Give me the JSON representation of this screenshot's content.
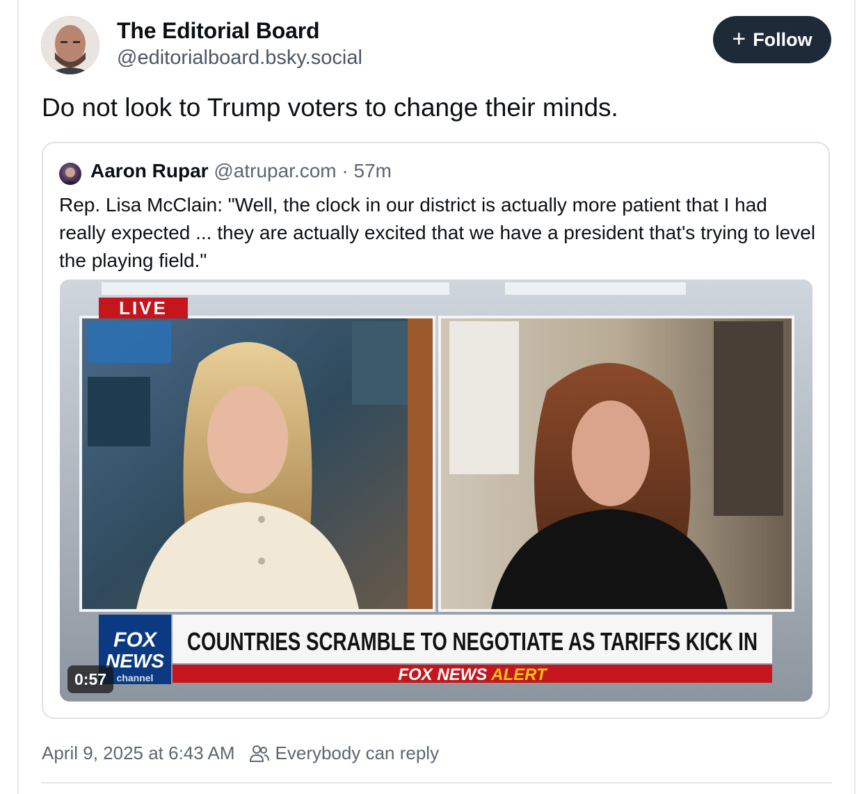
{
  "post": {
    "author": {
      "display_name": "The Editorial Board",
      "handle": "@editorialboard.bsky.social"
    },
    "follow_label": "Follow",
    "text": "Do not look to Trump voters to change their minds.",
    "timestamp": "April 9, 2025 at 6:43 AM",
    "reply_setting": "Everybody can reply"
  },
  "quote": {
    "author_name": "Aaron Rupar",
    "author_handle": "@atrupar.com",
    "separator": "·",
    "age": "57m",
    "text": "Rep. Lisa McClain: \"Well, the clock in our district is actually more patient that I had really expected ... they are actually excited that we have a president that's trying to level the playing field.\""
  },
  "video": {
    "duration": "0:57",
    "live_badge": "LIVE",
    "headline": "COUNTRIES SCRAMBLE TO NEGOTIATE AS TARIFFS KICK IN",
    "network_logo_line1": "FOX",
    "network_logo_line2": "NEWS",
    "network_logo_line3": "channel",
    "alert_prefix": "FOX NEWS",
    "alert_word": "ALERT"
  },
  "colors": {
    "follow_bg": "#1f2a38",
    "muted_text": "#5b6672",
    "fox_red": "#c4161c",
    "fox_blue": "#0b3a82",
    "alert_yellow": "#f5c518"
  }
}
